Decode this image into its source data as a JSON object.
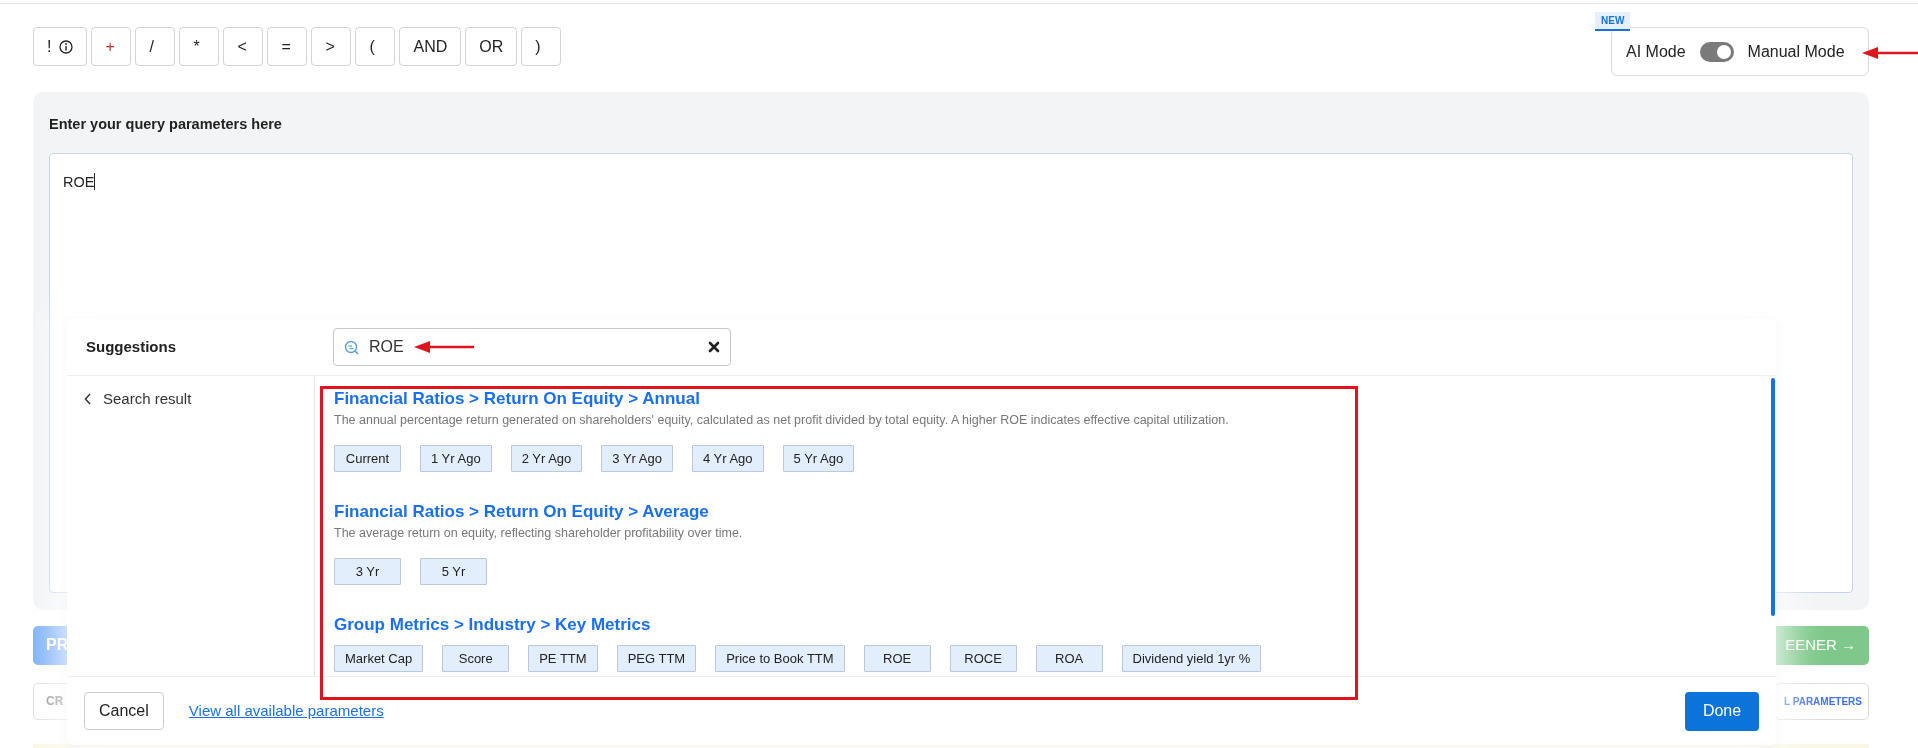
{
  "operators": [
    {
      "label": "!",
      "info": true
    },
    {
      "label": "+",
      "info": false
    },
    {
      "label": "/",
      "info": false
    },
    {
      "label": "*",
      "info": false
    },
    {
      "label": "<",
      "info": false
    },
    {
      "label": "=",
      "info": false
    },
    {
      "label": ">",
      "info": false
    },
    {
      "label": "(",
      "info": false
    },
    {
      "label": "AND",
      "info": false
    },
    {
      "label": "OR",
      "info": false
    },
    {
      "label": ")",
      "info": false
    }
  ],
  "mode_toggle": {
    "badge": "NEW",
    "left_label": "AI Mode",
    "right_label": "Manual Mode",
    "on": true
  },
  "query": {
    "label": "Enter your query parameters here",
    "value": "ROE"
  },
  "background_buttons": [
    {
      "text": "PR",
      "kind": "primary"
    },
    {
      "text": "EENER →",
      "kind": "success"
    },
    {
      "text": "CR",
      "kind": "outline"
    },
    {
      "text": "L PARAMETERS",
      "kind": "outline-link"
    }
  ],
  "suggestions": {
    "title": "Suggestions",
    "search": {
      "value": "ROE"
    },
    "back_label": "Search result",
    "results": [
      {
        "path": "Financial Ratios > Return On Equity > Annual",
        "description": "The annual percentage return generated on shareholders' equity, calculated as net profit divided by total equity. A higher ROE indicates effective capital utilization.",
        "options": [
          "Current",
          "1 Yr Ago",
          "2 Yr Ago",
          "3 Yr Ago",
          "4 Yr Ago",
          "5 Yr Ago"
        ]
      },
      {
        "path": "Financial Ratios > Return On Equity > Average",
        "description": "The average return on equity, reflecting shareholder profitability over time.",
        "options": [
          "3 Yr",
          "5 Yr"
        ]
      },
      {
        "path": "Group Metrics > Industry > Key Metrics",
        "options": [
          "Market Cap",
          "Score",
          "PE TTM",
          "PEG TTM",
          "Price to Book TTM",
          "ROE",
          "ROCE",
          "ROA",
          "Dividend yield 1yr %"
        ]
      }
    ],
    "cancel": "Cancel",
    "link": "View all available parameters",
    "done": "Done"
  }
}
